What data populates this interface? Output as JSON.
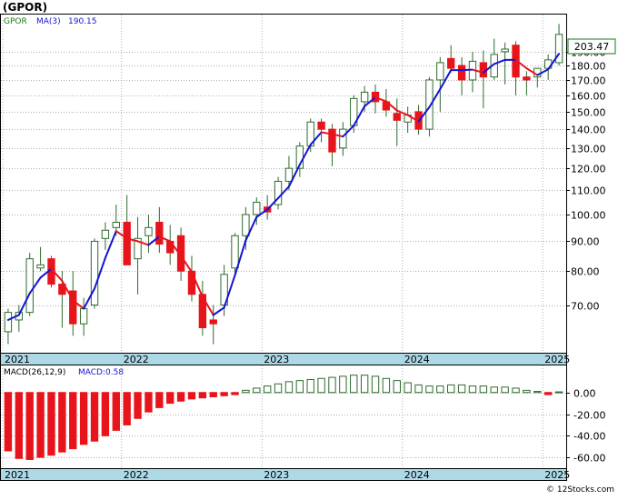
{
  "header": {
    "title": "(GPOR)",
    "legend_ticker": "GPOR",
    "legend_ma": "MA(3)",
    "legend_ma_value": "190.15",
    "last_price": "203.47"
  },
  "macd_legend": {
    "label": "MACD(26,12,9)",
    "value_label": "MACD:0.58"
  },
  "footer": {
    "copyright": "© 12Stocks.com"
  },
  "colors": {
    "up_candle": "#ffffff",
    "up_outline": "#2e6b2e",
    "down_candle": "#e8141b",
    "ma_up": "#1414d2",
    "ma_down": "#e8141b",
    "macd_pos": "#2e6b2e",
    "macd_neg": "#e8141b",
    "date_band": "#add8e6",
    "legend_ticker": "#1a7a1a",
    "legend_ma": "#1414d2"
  },
  "chart_data": [
    {
      "type": "candlestick",
      "title": "(GPOR)",
      "x_tick_labels": [
        "2021",
        "2022",
        "2023",
        "2024",
        "2025"
      ],
      "x_tick_index": [
        0,
        11,
        24,
        37,
        50
      ],
      "y_scale": "log",
      "ylim": [
        58,
        220
      ],
      "y_ticks": [
        70,
        80,
        90,
        100,
        110,
        120,
        130,
        140,
        150,
        160,
        170,
        180,
        190
      ],
      "y_tick_labels": [
        "70.00",
        "80.00",
        "90.00",
        "100.00",
        "110.00",
        "120.00",
        "130.00",
        "140.00",
        "150.00",
        "160.00",
        "170.00",
        "180.00",
        "190.00"
      ],
      "last_value_label": "203.47",
      "grid": true,
      "series": [
        {
          "name": "GPOR",
          "ohlc": [
            [
              63,
              69,
              60,
              68
            ],
            [
              66,
              70,
              63,
              68
            ],
            [
              68,
              86,
              67,
              84
            ],
            [
              81,
              88,
              80,
              82
            ],
            [
              84,
              85,
              75,
              76
            ],
            [
              76,
              80,
              64,
              73
            ],
            [
              74,
              80,
              62,
              65
            ],
            [
              65,
              72,
              62,
              69
            ],
            [
              70,
              91,
              69,
              90
            ],
            [
              91,
              97,
              87,
              94
            ],
            [
              95,
              104,
              92,
              97
            ],
            [
              97,
              108,
              82,
              82
            ],
            [
              84,
              99,
              73,
              91
            ],
            [
              92,
              100,
              86,
              95
            ],
            [
              97,
              103,
              86,
              89
            ],
            [
              90,
              96,
              82,
              86
            ],
            [
              92,
              95,
              77,
              80
            ],
            [
              80,
              85,
              71,
              73
            ],
            [
              73,
              77,
              62,
              64
            ],
            [
              66,
              70,
              60,
              65
            ],
            [
              70,
              82,
              67,
              79
            ],
            [
              81,
              93,
              79,
              92
            ],
            [
              92,
              103,
              87,
              100
            ],
            [
              100,
              107,
              96,
              105
            ],
            [
              103,
              108,
              98,
              101
            ],
            [
              104,
              116,
              102,
              114
            ],
            [
              114,
              126,
              110,
              120
            ],
            [
              120,
              133,
              116,
              131
            ],
            [
              131,
              146,
              128,
              144
            ],
            [
              144,
              146,
              133,
              140
            ],
            [
              140,
              143,
              121,
              128
            ],
            [
              130,
              144,
              126,
              140
            ],
            [
              142,
              160,
              138,
              158
            ],
            [
              156,
              166,
              150,
              162
            ],
            [
              162,
              167,
              149,
              156
            ],
            [
              156,
              164,
              147,
              151
            ],
            [
              149,
              158,
              131,
              145
            ],
            [
              144,
              153,
              138,
              148
            ],
            [
              150,
              154,
              137,
              140
            ],
            [
              140,
              172,
              136,
              170
            ],
            [
              170,
              186,
              150,
              182
            ],
            [
              185,
              195,
              175,
              178
            ],
            [
              180,
              186,
              160,
              170
            ],
            [
              170,
              190,
              162,
              183
            ],
            [
              182,
              191,
              152,
              172
            ],
            [
              172,
              200,
              170,
              188
            ],
            [
              190,
              197,
              167,
              192
            ],
            [
              195,
              198,
              160,
              172
            ],
            [
              172,
              176,
              160,
              170
            ],
            [
              172,
              178,
              165,
              178
            ],
            [
              178,
              188,
              170,
              184
            ],
            [
              182,
              212,
              180,
              203.47
            ]
          ]
        },
        {
          "name": "MA(3)",
          "values": [
            66,
            67.3,
            73.3,
            78,
            80.7,
            77,
            71.3,
            69,
            74.7,
            84.3,
            93.7,
            91,
            90,
            88.7,
            91.7,
            90,
            85,
            79.7,
            72.3,
            67.3,
            69.3,
            78.7,
            90.3,
            99,
            102,
            106.7,
            111.7,
            121.7,
            131.7,
            138.3,
            137.3,
            136,
            142,
            153.3,
            158.7,
            156.3,
            150.7,
            148,
            144.3,
            152.7,
            164,
            176.7,
            176.7,
            177,
            175,
            181,
            184,
            184,
            178,
            173.3,
            177.3,
            188.5
          ]
        }
      ]
    },
    {
      "type": "bar",
      "title": "MACD(26,12,9)",
      "y_ticks": [
        0,
        -20,
        -40,
        -60
      ],
      "y_tick_labels": [
        "0.00",
        "-20.00",
        "-40.00",
        "-60.00"
      ],
      "ylim": [
        -70,
        25
      ],
      "x_tick_labels": [
        "2021",
        "2022",
        "2023",
        "2024",
        "2025"
      ],
      "series": [
        {
          "name": "MACD",
          "values": [
            -54,
            -61,
            -62,
            -60,
            -58,
            -55,
            -52,
            -48,
            -45,
            -40,
            -35,
            -30,
            -24,
            -18,
            -14,
            -10,
            -8,
            -6,
            -5,
            -4,
            -3,
            -2,
            2,
            4,
            6,
            8,
            10,
            11,
            12,
            13,
            14,
            15,
            16,
            16,
            15,
            13,
            11,
            9,
            7,
            6,
            6,
            7,
            7,
            6,
            6,
            5,
            5,
            4,
            2,
            1,
            -2,
            0.58
          ]
        }
      ]
    }
  ]
}
